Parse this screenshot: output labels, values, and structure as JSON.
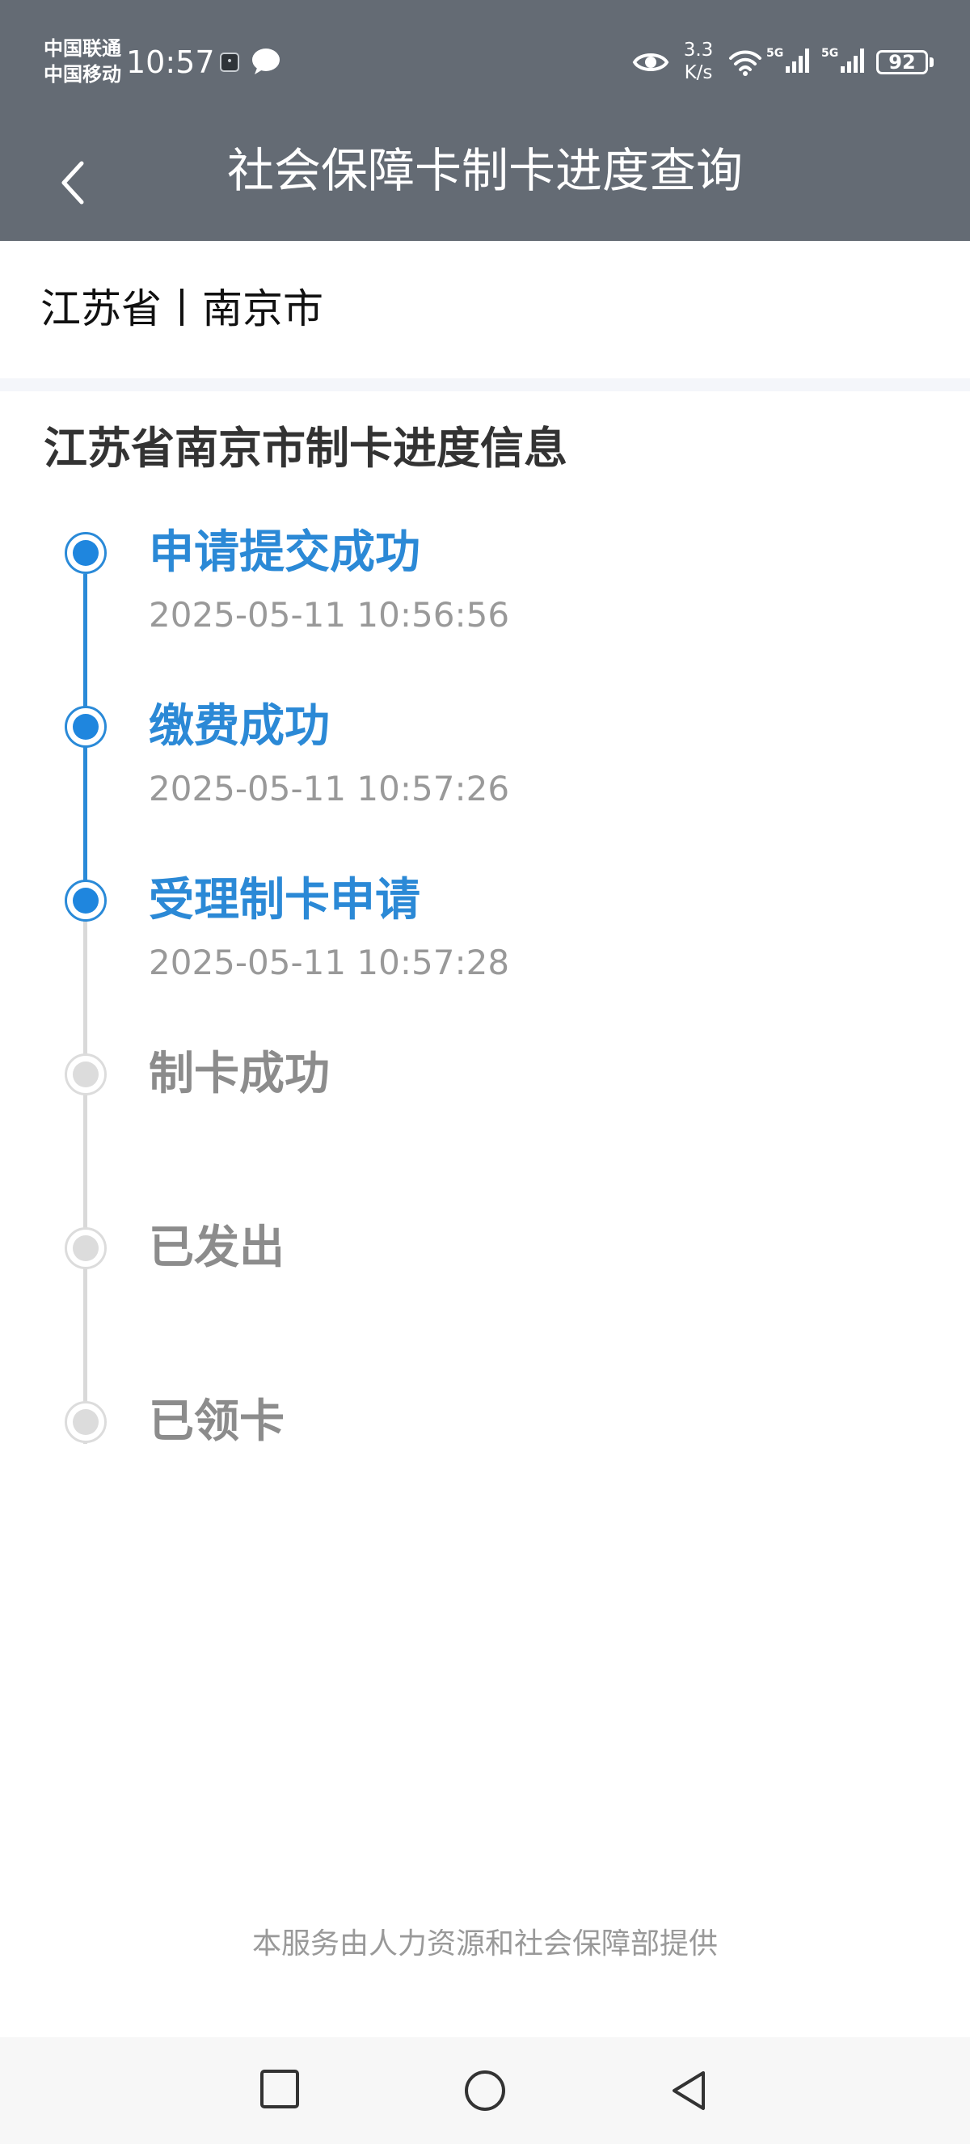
{
  "status_bar": {
    "carrier_1": "中国联通",
    "carrier_2": "中国移动",
    "time": "10:57",
    "speed_value": "3.3",
    "speed_unit": "K/s",
    "signal_1_label": "5G",
    "signal_2_label": "5G",
    "battery": "92"
  },
  "header": {
    "title": "社会保障卡制卡进度查询"
  },
  "region": {
    "text": "江苏省丨南京市"
  },
  "progress": {
    "title": "江苏省南京市制卡进度信息",
    "steps": [
      {
        "label": "申请提交成功",
        "time": "2025-05-11 10:56:56",
        "done": true
      },
      {
        "label": "缴费成功",
        "time": "2025-05-11 10:57:26",
        "done": true
      },
      {
        "label": "受理制卡申请",
        "time": "2025-05-11 10:57:28",
        "done": true
      },
      {
        "label": "制卡成功",
        "time": "",
        "done": false
      },
      {
        "label": "已发出",
        "time": "",
        "done": false
      },
      {
        "label": "已领卡",
        "time": "",
        "done": false
      }
    ]
  },
  "footer": {
    "note": "本服务由人力资源和社会保障部提供"
  },
  "colors": {
    "header_bg": "#646b74",
    "accent": "#2a8ad8",
    "inactive": "#dcdcdc",
    "muted_text": "#999999"
  }
}
